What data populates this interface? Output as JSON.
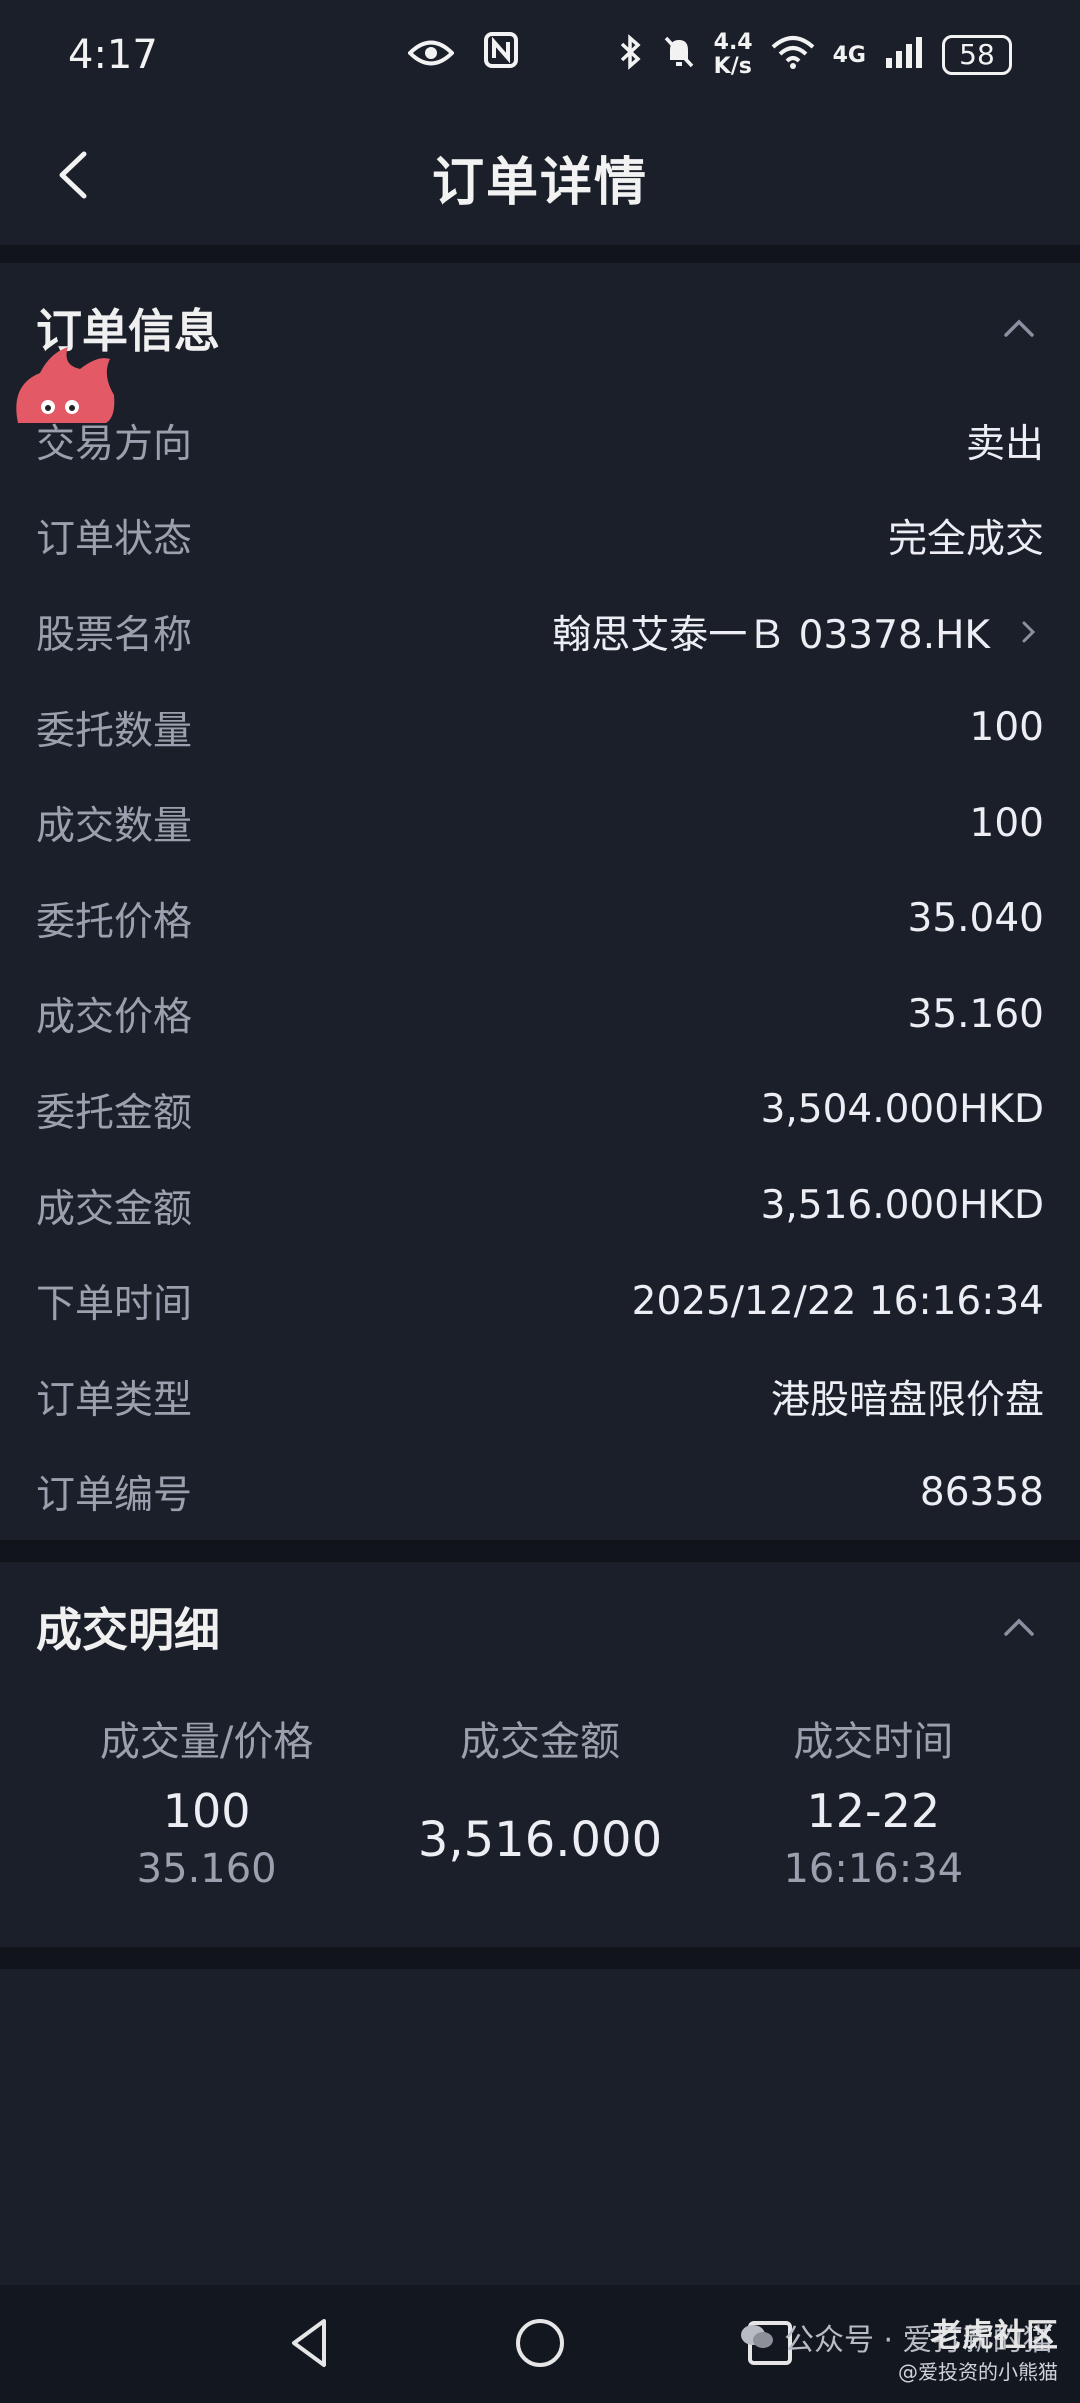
{
  "status_bar": {
    "time": "4:17",
    "net_speed_top": "4.4",
    "net_speed_bottom": "K/s",
    "signal_label": "4G",
    "battery": "58"
  },
  "header": {
    "title": "订单详情"
  },
  "order_info": {
    "title": "订单信息",
    "rows": [
      {
        "label": "交易方向",
        "value": "卖出"
      },
      {
        "label": "订单状态",
        "value": "完全成交"
      },
      {
        "label": "股票名称",
        "value": "翰思艾泰一Ｂ 03378.HK"
      },
      {
        "label": "委托数量",
        "value": "100"
      },
      {
        "label": "成交数量",
        "value": "100"
      },
      {
        "label": "委托价格",
        "value": "35.040"
      },
      {
        "label": "成交价格",
        "value": "35.160"
      },
      {
        "label": "委托金额",
        "value": "3,504.000HKD"
      },
      {
        "label": "成交金额",
        "value": "3,516.000HKD"
      },
      {
        "label": "下单时间",
        "value": "2025/12/22 16:16:34"
      },
      {
        "label": "订单类型",
        "value": "港股暗盘限价盘"
      },
      {
        "label": "订单编号",
        "value": "86358"
      }
    ]
  },
  "fills": {
    "title": "成交明细",
    "headers": [
      "成交量/价格",
      "成交金额",
      "成交时间"
    ],
    "row": {
      "qty": "100",
      "price": "35.160",
      "amount": "3,516.000",
      "date": "12-22",
      "time": "16:16:34"
    }
  },
  "watermark": {
    "text": "公众号 · 爱打新的猫",
    "brand": "老虎社区",
    "handle": "@爱投资的小熊猫"
  },
  "colors": {
    "background": "#1b1f2a",
    "divider": "#11141b",
    "label": "#9aa0ad",
    "value": "#eceef3"
  }
}
